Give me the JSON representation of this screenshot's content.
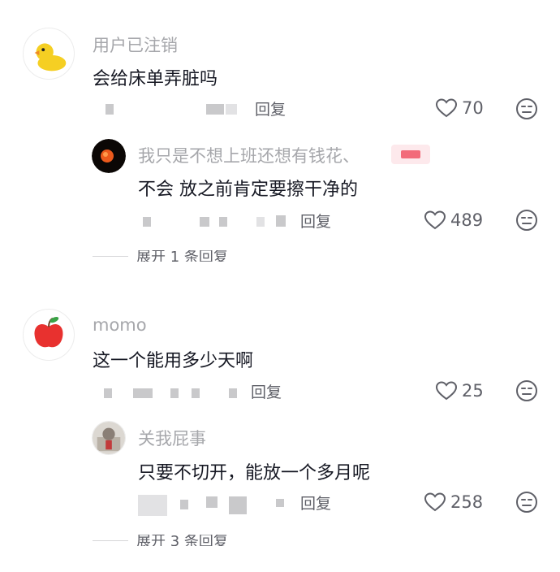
{
  "comments": [
    {
      "username": "用户已注销",
      "text": "会给床单弄脏吗",
      "reply_label": "回复",
      "likes": "70",
      "avatar_icon": "duck-icon",
      "replies": [
        {
          "username": "我只是不想上班还想有钱花、",
          "text": "不会 放之前肯定要擦干净的",
          "reply_label": "回复",
          "likes": "489",
          "avatar_icon": "orange-dot-icon"
        }
      ],
      "expand_label": "展开 1 条回复"
    },
    {
      "username": "momo",
      "text": "这一个能用多少天啊",
      "reply_label": "回复",
      "likes": "25",
      "avatar_icon": "apple-icon",
      "replies": [
        {
          "username": "关我屁事",
          "text": "只要不切开，能放一个多月呢",
          "reply_label": "回复",
          "likes": "258",
          "avatar_icon": "photo-avatar-icon"
        }
      ],
      "expand_label": "展开 3 条回复"
    }
  ],
  "icons": {
    "like": "heart-outline-icon",
    "dislike": "frown-face-icon"
  },
  "colors": {
    "text": "#161823",
    "username": "#a6a7ab",
    "meta": "#5f6068",
    "background": "#ffffff"
  }
}
